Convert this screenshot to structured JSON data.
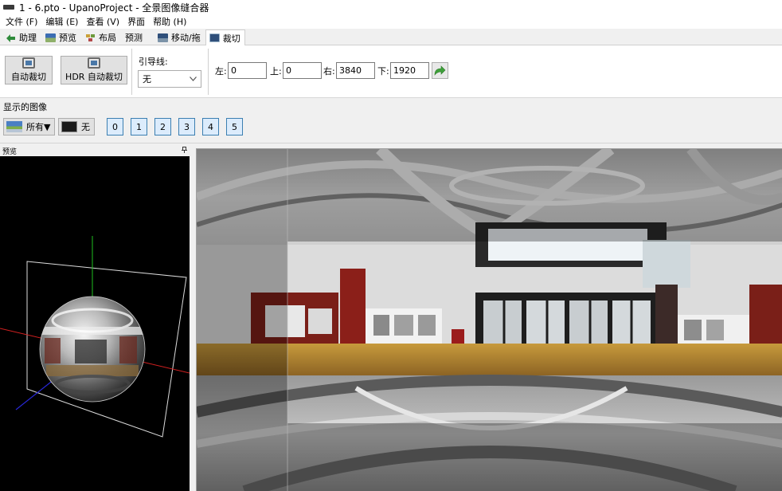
{
  "window": {
    "title": "1 - 6.pto - UpanoProject - 全景图像缝合器"
  },
  "menu": [
    "文件 (F)",
    "编辑 (E)",
    "查看 (V)",
    "界面",
    "帮助 (H)"
  ],
  "tabs": [
    {
      "label": "助理",
      "icon": "assistant-icon"
    },
    {
      "label": "预览",
      "icon": "preview-icon"
    },
    {
      "label": "布局",
      "icon": "layout-icon"
    },
    {
      "label": "预测",
      "icon": ""
    },
    {
      "label": "移动/拖",
      "icon": "move-drag-icon"
    },
    {
      "label": "裁切",
      "icon": "crop-tab-icon",
      "active": true
    }
  ],
  "crop": {
    "auto_crop": "自动裁切",
    "hdr_auto_crop": "HDR 自动裁切",
    "guide_label": "引导线:",
    "guide_value": "无",
    "left_label": "左:",
    "left_value": "0",
    "top_label": "上:",
    "top_value": "0",
    "right_label": "右:",
    "right_value": "3840",
    "bottom_label": "下:",
    "bottom_value": "1920"
  },
  "shown_images": {
    "label": "显示的图像",
    "all_label": "所有▼",
    "none_label": "无",
    "image_buttons": [
      "0",
      "1",
      "2",
      "3",
      "4",
      "5"
    ]
  },
  "preview": {
    "label": "预览",
    "pin": "ᵖ"
  },
  "colors": {
    "crop_overlay": "#000000",
    "image_toggle_border": "#3c7fb1",
    "image_toggle_fill": "#dcecfc",
    "axis_x": "#d02020",
    "axis_y": "#20c020",
    "axis_z": "#2020d0"
  }
}
